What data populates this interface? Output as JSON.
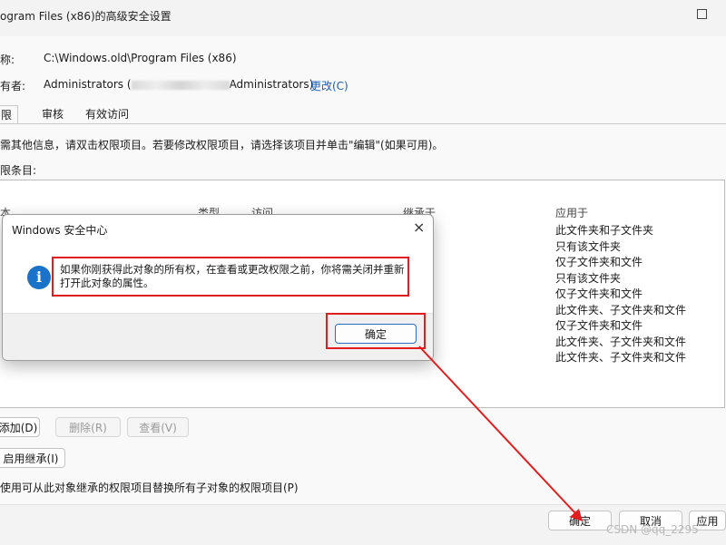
{
  "window": {
    "title": "ogram Files (x86)的高级安全设置"
  },
  "name_row": {
    "label": "称:",
    "value": "C:\\Windows.old\\Program Files (x86)"
  },
  "owner_row": {
    "label": "有者:",
    "value_prefix": "Administrators (",
    "value_suffix": "Administrators)",
    "change_link": "更改(C)"
  },
  "tabs": [
    {
      "label": "限"
    },
    {
      "label": "审核"
    },
    {
      "label": "有效访问"
    }
  ],
  "info_text": "需其他信息，请双击权限项目。若要修改权限项目，请选择该项目并单击\"编辑\"(如果可用)。",
  "entries_label": "限条目:",
  "columns": {
    "type": "本",
    "kind": "类型",
    "access": "访问",
    "inherited": "继承于",
    "applies": "应用于"
  },
  "applies_to": [
    "此文件夹和子文件夹",
    "只有该文件夹",
    "仅子文件夹和文件",
    "只有该文件夹",
    "仅子文件夹和文件",
    "此文件夹、子文件夹和文件",
    "仅子文件夹和文件",
    "此文件夹、子文件夹和文件",
    "此文件夹、子文件夹和文件"
  ],
  "buttons": {
    "add": "添加(D)",
    "remove": "删除(R)",
    "view": "查看(V)",
    "enable_inheritance": "启用继承(I)",
    "replace_checkbox": "使用可从此对象继承的权限项目替换所有子对象的权限项目(P)"
  },
  "footer": {
    "ok": "确定",
    "cancel": "取消",
    "apply": "应用"
  },
  "dialog": {
    "title": "Windows 安全中心",
    "message_line1": "如果你刚获得此对象的所有权，在查看或更改权限之前，你将需关闭并重新",
    "message_line2": "打开此对象的属性。",
    "ok": "确定"
  },
  "watermark": "CSDN @qq_2295",
  "colors": {
    "highlight": "#e21d1d",
    "accent": "#1a73c8",
    "link": "#1a5fb4"
  }
}
